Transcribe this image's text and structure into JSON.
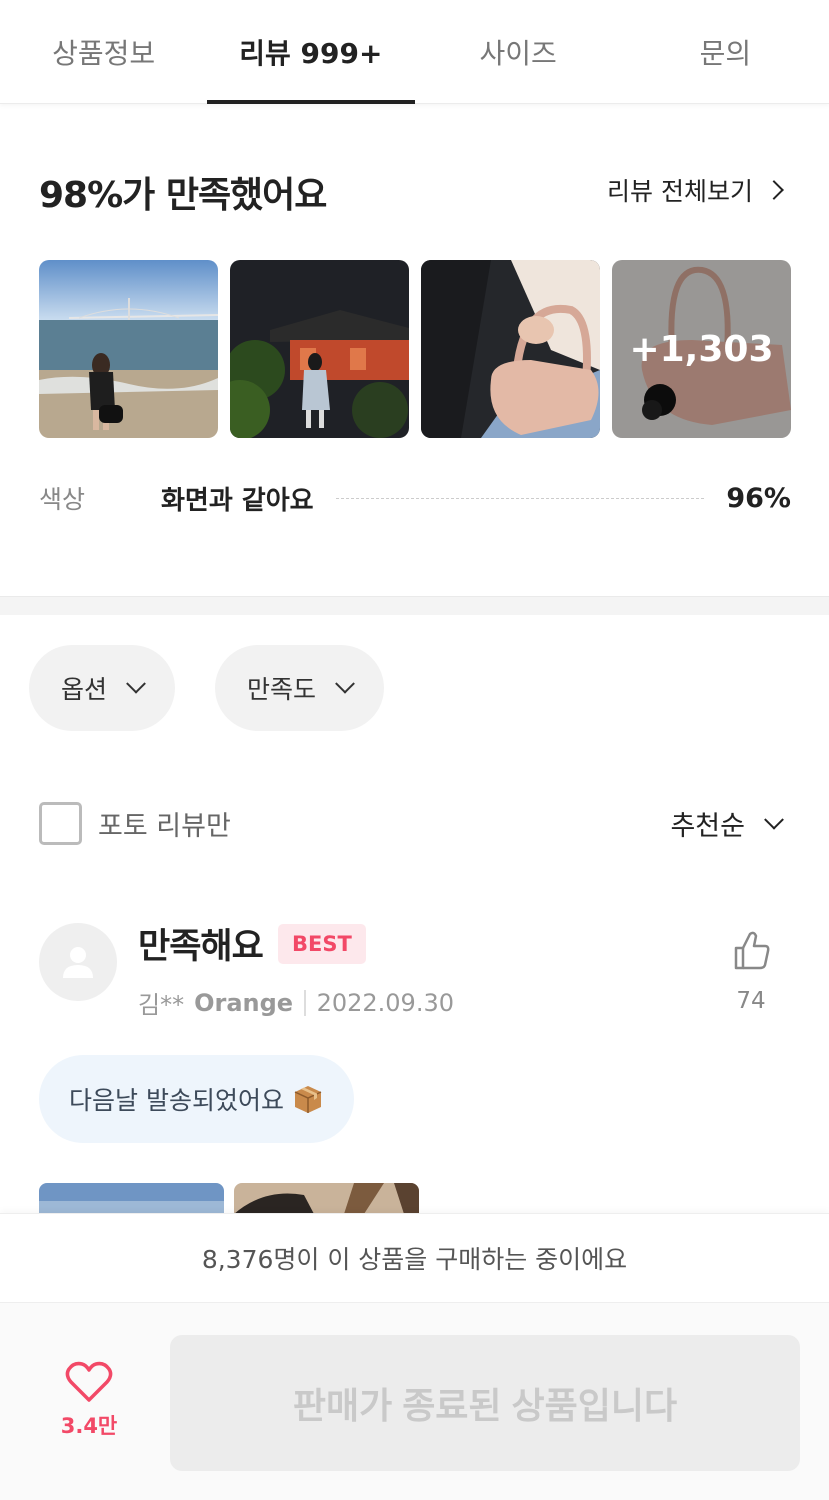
{
  "tabs": [
    {
      "label": "상품정보",
      "active": false
    },
    {
      "label": "리뷰 999+",
      "active": true
    },
    {
      "label": "사이즈",
      "active": false
    },
    {
      "label": "문의",
      "active": false
    }
  ],
  "summary": {
    "title": "98%가 만족했어요",
    "view_all_label": "리뷰 전체보기",
    "more_photos_count": "+1,303",
    "attribute": {
      "label": "색상",
      "value": "화면과 같아요",
      "percent": "96%"
    }
  },
  "filters": {
    "option_label": "옵션",
    "satisfaction_label": "만족도",
    "photo_only_label": "포토 리뷰만",
    "sort_label": "추천순"
  },
  "review": {
    "title": "만족해요",
    "badge": "BEST",
    "user": "김**",
    "option": "Orange",
    "date": "2022.09.30",
    "likes": "74",
    "tag": "다음날 발송되었어요"
  },
  "bottom": {
    "buyers_text": "8,376명이 이 상품을 구매하는 중이에요",
    "wish_count": "3.4만",
    "buy_button_label": "판매가 종료된 상품입니다"
  },
  "colors": {
    "accent_pink": "#f24967",
    "badge_bg": "#fde8ec",
    "tag_bg": "#eef5fc"
  }
}
